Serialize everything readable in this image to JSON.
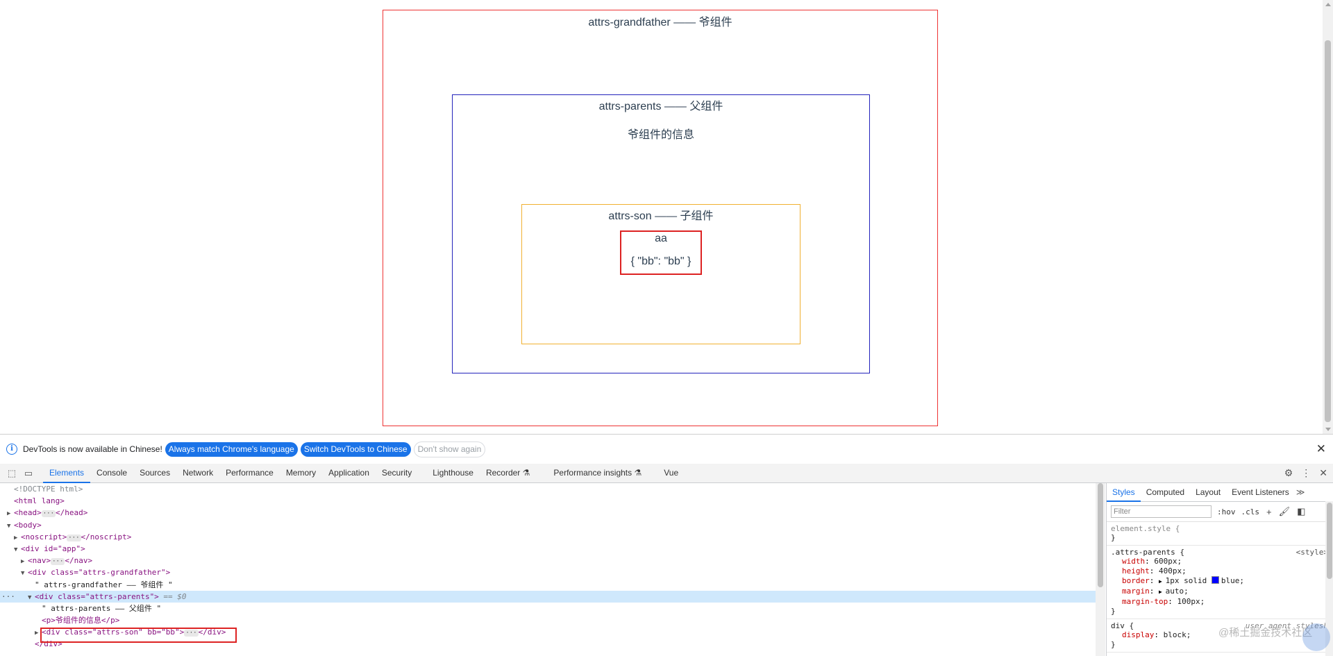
{
  "page": {
    "grandfather": {
      "title": "attrs-grandfather —— 爷组件"
    },
    "parents": {
      "title": "attrs-parents —— 父组件",
      "info": "爷组件的信息"
    },
    "son": {
      "title": "attrs-son —— 子组件",
      "line1": "aa",
      "line2": "{ \"bb\": \"bb\" }"
    }
  },
  "devtools": {
    "infobar": {
      "message": "DevTools is now available in Chinese!",
      "btn_match": "Always match Chrome's language",
      "btn_switch": "Switch DevTools to Chinese",
      "btn_dont": "Don't show again"
    },
    "tabs": [
      "Elements",
      "Console",
      "Sources",
      "Network",
      "Performance",
      "Memory",
      "Application",
      "Security",
      "Lighthouse",
      "Recorder",
      "Performance insights",
      "Vue"
    ],
    "elements_lines": [
      {
        "indent": 1,
        "text": "<!DOCTYPE html>",
        "kind": "cmt"
      },
      {
        "indent": 1,
        "text": "<html lang>",
        "kind": "tag"
      },
      {
        "indent": 1,
        "text": "<head>",
        "after": "</head>",
        "arrow": "right",
        "kind": "tag"
      },
      {
        "indent": 1,
        "text": "<body>",
        "arrow": "down",
        "kind": "tag"
      },
      {
        "indent": 2,
        "text": "<noscript>",
        "after": "</noscript>",
        "arrow": "right",
        "kind": "tag"
      },
      {
        "indent": 2,
        "text": "<div id=\"app\">",
        "arrow": "down",
        "kind": "tag"
      },
      {
        "indent": 3,
        "text": "<nav>",
        "after": "</nav>",
        "arrow": "right",
        "kind": "tag"
      },
      {
        "indent": 3,
        "text": "<div class=\"attrs-grandfather\">",
        "arrow": "down",
        "kind": "tag"
      },
      {
        "indent": 4,
        "text": "\" attrs-grandfather —— 爷组件 \"",
        "kind": "txt"
      },
      {
        "indent": 4,
        "text": "<div class=\"attrs-parents\">",
        "suffix": " == $0",
        "arrow": "down",
        "kind": "tag",
        "selected": true
      },
      {
        "indent": 5,
        "text": "\" attrs-parents —— 父组件 \"",
        "kind": "txt"
      },
      {
        "indent": 5,
        "text": "<p>爷组件的信息</p>",
        "kind": "tag"
      },
      {
        "indent": 5,
        "text": "<div class=\"attrs-son\" bb=\"bb\">",
        "after": "</div>",
        "arrow": "right",
        "kind": "tag"
      },
      {
        "indent": 4,
        "text": "</div>",
        "kind": "tag"
      }
    ],
    "styles_tabs": [
      "Styles",
      "Computed",
      "Layout",
      "Event Listeners"
    ],
    "filter_placeholder": "Filter",
    "hov": ":hov",
    "cls": ".cls",
    "rules": [
      {
        "selector": "element.style {",
        "dim": true,
        "decls": [],
        "close": "}"
      },
      {
        "selector": ".attrs-parents {",
        "source": "<style>",
        "decls": [
          {
            "p": "width",
            "v": "600px;"
          },
          {
            "p": "height",
            "v": "400px;"
          },
          {
            "p": "border",
            "v": "1px solid ",
            "color": "#0000ff",
            "v2": "blue;"
          },
          {
            "p": "margin",
            "v": "auto;"
          },
          {
            "p": "margin-top",
            "v": "100px;"
          }
        ],
        "close": "}"
      },
      {
        "selector": "div {",
        "source": "user agent stylesh",
        "decls": [
          {
            "p": "display",
            "v": "block;"
          }
        ],
        "close": "}"
      }
    ],
    "watermark": "@稀土掘金技术社区"
  }
}
